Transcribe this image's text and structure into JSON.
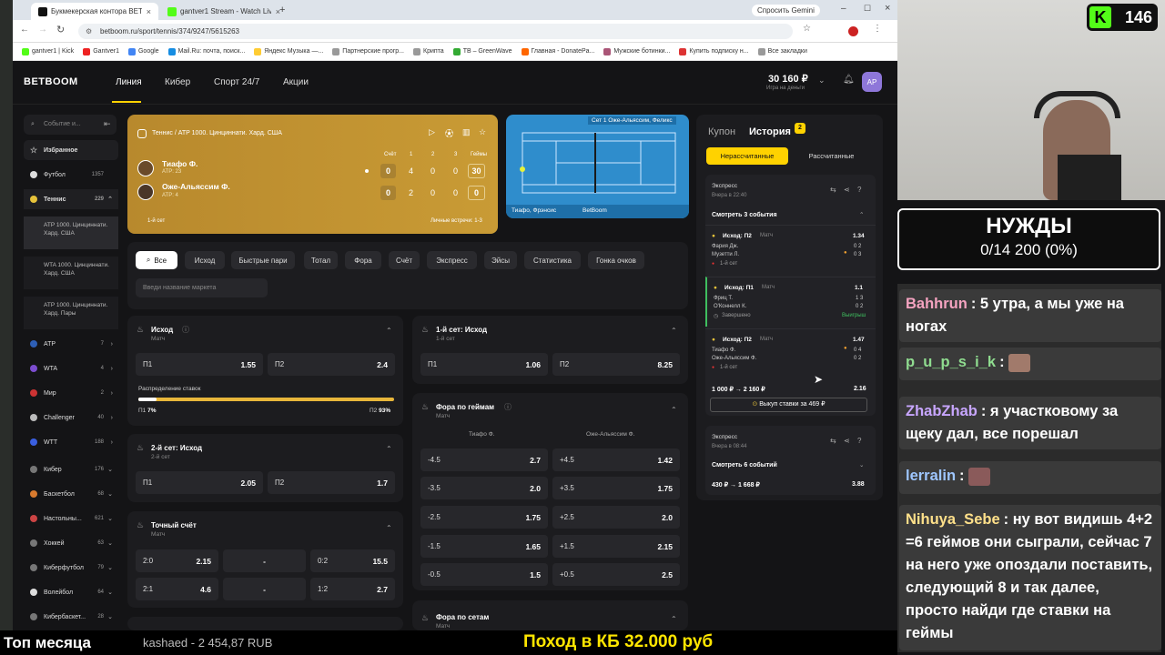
{
  "browser": {
    "tabs": [
      {
        "label": "Букмекерская контора BETBOOM",
        "active": true
      },
      {
        "label": "gantver1 Stream - Watch Live on...",
        "active": false
      }
    ],
    "ask_gemini": "Спросить Gemini",
    "url": "betboom.ru/sport/tennis/374/9247/5615263",
    "bookmarks": [
      "gantver1 | Kick",
      "Gantver1",
      "Google",
      "Mail.Ru: почта, поиск...",
      "Яндекс Музыка —...",
      "Партнерские прогр...",
      "Крипта",
      "TB – GreenWave",
      "Главная - DonatePa...",
      "Мужские ботинки...",
      "Купить подписку н..."
    ],
    "all_bookmarks": "Все закладки"
  },
  "site": {
    "logo": "BETBOOM",
    "nav": [
      "Линия",
      "Кибер",
      "Спорт 24/7",
      "Акции"
    ],
    "balance": "30 160 ₽",
    "balance_sub": "Игра на деньги",
    "avatar": "АР"
  },
  "sidebar": {
    "search_placeholder": "Событие и...",
    "items": [
      {
        "label": "Избранное",
        "count": ""
      },
      {
        "label": "Футбол",
        "count": "1357"
      },
      {
        "label": "Теннис",
        "count": "229"
      }
    ],
    "subitems": [
      "ATP 1000. Цинциннати. Хард. США",
      "WTA 1000. Цинциннати. Хард. США",
      "ATP 1000. Цинциннати. Хард. Пары"
    ],
    "sports": [
      {
        "label": "ATP",
        "count": "7"
      },
      {
        "label": "WTA",
        "count": "4"
      },
      {
        "label": "Мир",
        "count": "2"
      },
      {
        "label": "Challenger",
        "count": "40"
      },
      {
        "label": "WTT",
        "count": "188"
      },
      {
        "label": "Кибер",
        "count": "176"
      },
      {
        "label": "Баскетбол",
        "count": "68"
      },
      {
        "label": "Настольны...",
        "count": "621"
      },
      {
        "label": "Хоккей",
        "count": "63"
      },
      {
        "label": "Киберфутбол",
        "count": "79"
      },
      {
        "label": "Волейбол",
        "count": "64"
      },
      {
        "label": "Кибербаскет...",
        "count": "28"
      }
    ]
  },
  "match": {
    "breadcrumb": "Теннис  /  ATP 1000. Цинциннати. Хард. США",
    "headers": [
      "Счёт",
      "1",
      "2",
      "3",
      "Геймы"
    ],
    "players": [
      {
        "name": "Тиафо Ф.",
        "rank": "ATP: 23",
        "serving": true,
        "scores": [
          "0",
          "4",
          "0",
          "0",
          "30"
        ]
      },
      {
        "name": "Оже-Альяссим Ф.",
        "rank": "ATP: 4",
        "serving": false,
        "scores": [
          "0",
          "2",
          "0",
          "0",
          "0"
        ]
      }
    ],
    "set_label": "1-й сет",
    "h2h": "Личные встречи: 1-3",
    "court_top": "Сет 1 Оже-Альяссим, Феликс",
    "court_bottom": "Тиафо, Фрэнсис",
    "court_brand": "BetBoom"
  },
  "filters": {
    "chips": [
      "Все",
      "Исход",
      "Быстрые пари",
      "Тотал",
      "Фора",
      "Счёт",
      "Экспресс",
      "Эйсы",
      "Статистика",
      "Гонка очков"
    ],
    "market_placeholder": "Введи название маркета"
  },
  "markets": {
    "outcome": {
      "title": "Исход",
      "sub": "Матч",
      "p1": "П1",
      "p1_odd": "1.55",
      "p2": "П2",
      "p2_odd": "2.4",
      "dist_label": "Распределение ставок",
      "dist_p1": "П1",
      "dist_p1_pct": "7%",
      "dist_p2": "П2",
      "dist_p2_pct": "93%",
      "dist_p1_value": 0.07
    },
    "set1": {
      "title": "1-й сет: Исход",
      "sub": "1-й сет",
      "p1": "П1",
      "p1_odd": "1.06",
      "p2": "П2",
      "p2_odd": "8.25"
    },
    "set2": {
      "title": "2-й сет: Исход",
      "sub": "2-й сет",
      "p1": "П1",
      "p1_odd": "2.05",
      "p2": "П2",
      "p2_odd": "1.7"
    },
    "handicap": {
      "title": "Фора по геймам",
      "sub": "Матч",
      "col1": "Тиафо Ф.",
      "col2": "Оже-Альяссим Ф.",
      "rows": [
        {
          "a": "-4.5",
          "ao": "2.7",
          "b": "+4.5",
          "bo": "1.42"
        },
        {
          "a": "-3.5",
          "ao": "2.0",
          "b": "+3.5",
          "bo": "1.75"
        },
        {
          "a": "-2.5",
          "ao": "1.75",
          "b": "+2.5",
          "bo": "2.0"
        },
        {
          "a": "-1.5",
          "ao": "1.65",
          "b": "+1.5",
          "bo": "2.15"
        },
        {
          "a": "-0.5",
          "ao": "1.5",
          "b": "+0.5",
          "bo": "2.5"
        }
      ]
    },
    "exact": {
      "title": "Точный счёт",
      "sub": "Матч",
      "rows": [
        {
          "a": "2:0",
          "ao": "2.15",
          "m": "-",
          "b": "0:2",
          "bo": "15.5"
        },
        {
          "a": "2:1",
          "ao": "4.6",
          "m": "-",
          "b": "1:2",
          "bo": "2.7"
        }
      ]
    },
    "sets_handicap": {
      "title": "Фора по сетам",
      "sub": "Матч"
    }
  },
  "coupon": {
    "tab_coupon": "Купон",
    "tab_history": "История",
    "history_badge": "2",
    "sub_unsettled": "Нерассчитанные",
    "sub_settled": "Рассчитанные",
    "bet1": {
      "type": "Экспресс",
      "time": "Вчера в 22:40",
      "toggle": "Смотреть 3 события",
      "legs": [
        {
          "market": "Исход: П2",
          "scope": "Матч",
          "odd": "1.34",
          "p1": "Фария Дж.",
          "p2": "Музетти Л.",
          "s1": "0 2",
          "s2": "0 3",
          "status": "1-й сет"
        },
        {
          "market": "Исход: П1",
          "scope": "Матч",
          "odd": "1.1",
          "p1": "Фриц Т.",
          "p2": "О'Коннелл К.",
          "s1": "1 3",
          "s2": "0 2",
          "status": "Завершено",
          "result": "Выигрыш"
        },
        {
          "market": "Исход: П2",
          "scope": "Матч",
          "odd": "1.47",
          "p1": "Тиафо Ф.",
          "p2": "Оже-Альяссим Ф.",
          "s1": "0 4",
          "s2": "0 2",
          "status": "1-й сет"
        }
      ],
      "stake": "1 000 ₽ → 2 160 ₽",
      "total_odd": "2.16",
      "cashout": "Выкуп ставки за 469 ₽"
    },
    "bet2": {
      "type": "Экспресс",
      "time": "Вчера в 08:44",
      "toggle": "Смотреть 6 событий",
      "stake": "430 ₽ → 1 668 ₽",
      "total_odd": "3.88"
    }
  },
  "stream": {
    "viewers": "146",
    "goal_title": "НУЖДЫ",
    "goal_progress": "0/14 200 (0%)",
    "chat": [
      {
        "user": "Bahhrun",
        "color": "#f4a3c0",
        "text": ": 5 утра, а мы уже на ногах"
      },
      {
        "user": "p_u_p_s_i_k",
        "color": "#8fdc8f",
        "text": ":",
        "emote": true
      },
      {
        "user": "ZhabZhab",
        "color": "#c8a6ff",
        "text": ": я участковому за щеку дал, все порешал"
      },
      {
        "user": "lerralin",
        "color": "#9ec6ff",
        "text": ":",
        "emote": true
      },
      {
        "user": "Nihuya_Sebe",
        "color": "#ffe08a",
        "text": ": ну вот видишь 4+2 =6 геймов они сыграли, сейчас 7 на него уже опоздали поставить, следующий 8 и так далее, просто найди где ставки на геймы"
      }
    ],
    "top_month": "Топ месяца",
    "top_donor": "kashaed - 2 454,87 RUB",
    "banner": "Поход в КБ 32.000 руб"
  },
  "colors": {
    "accent": "#ffd200",
    "card": "#c99b35",
    "court": "#2f8dcc",
    "win": "#3fbf5f"
  }
}
